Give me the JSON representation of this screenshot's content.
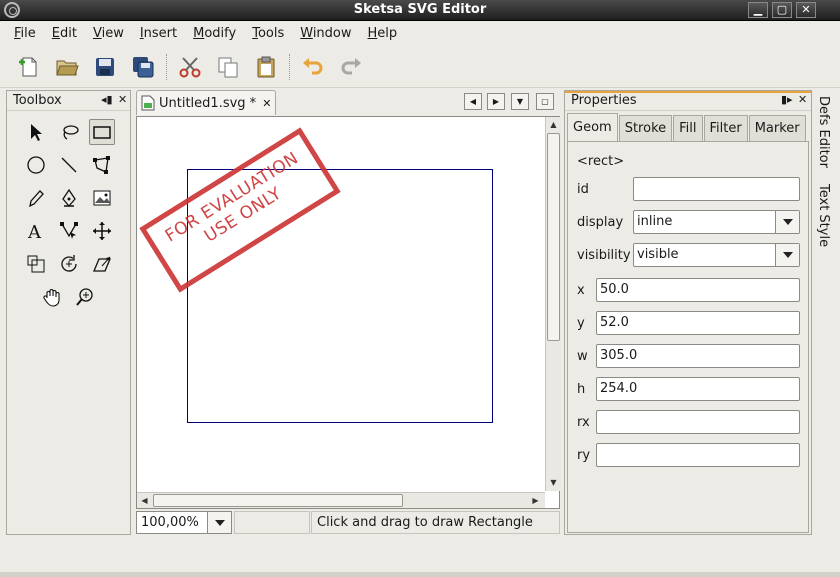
{
  "window": {
    "title": "Sketsa SVG Editor"
  },
  "menu": {
    "items": [
      {
        "underline": "F",
        "rest": "ile"
      },
      {
        "underline": "E",
        "rest": "dit"
      },
      {
        "underline": "V",
        "rest": "iew"
      },
      {
        "underline": "I",
        "rest": "nsert"
      },
      {
        "underline": "M",
        "rest": "odify"
      },
      {
        "underline": "T",
        "rest": "ools"
      },
      {
        "underline": "W",
        "rest": "indow"
      },
      {
        "underline": "H",
        "rest": "elp"
      }
    ]
  },
  "toolbox": {
    "title": "Toolbox"
  },
  "document": {
    "tab_name": "Untitled1.svg *",
    "stamp_line1": "FOR EVALUATION",
    "stamp_line2": "USE ONLY"
  },
  "status": {
    "zoom": "100,00%",
    "message": "Click and drag to draw Rectangle"
  },
  "properties": {
    "title": "Properties",
    "tabs": [
      "Geom",
      "Stroke",
      "Fill",
      "Filter",
      "Marker"
    ],
    "element": "<rect>",
    "labels": {
      "id": "id",
      "display": "display",
      "visibility": "visibility",
      "x": "x",
      "y": "y",
      "w": "w",
      "h": "h",
      "rx": "rx",
      "ry": "ry"
    },
    "values": {
      "id": "",
      "display": "inline",
      "visibility": "visible",
      "x": "50.0",
      "y": "52.0",
      "w": "305.0",
      "h": "254.0",
      "rx": "",
      "ry": ""
    }
  },
  "side_dock": {
    "defs_editor": "Defs Editor",
    "text_style": "Text Style"
  },
  "colors": {
    "accent_orange": "#e8a33c",
    "stamp_red": "#cc3333",
    "rect_stroke": "#000080"
  }
}
